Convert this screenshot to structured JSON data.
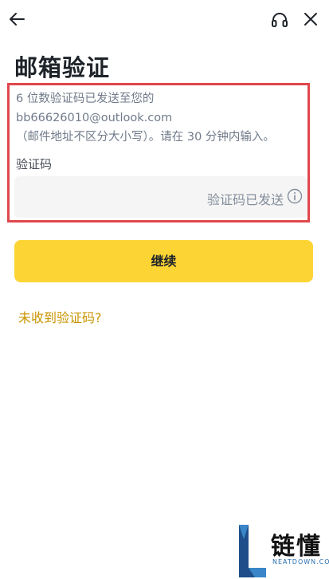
{
  "header": {
    "back_icon": "arrow-left-icon",
    "support_icon": "headset-icon",
    "close_icon": "close-icon"
  },
  "title": "邮箱验证",
  "info": {
    "line1": "6 位数验证码已发送至您的 bb66626010@outlook.com",
    "line2": "（邮件地址不区分大小写）。请在 30 分钟内输入。"
  },
  "code_field": {
    "label": "验证码",
    "value": "",
    "status": "验证码已发送",
    "status_icon": "info-circle-icon"
  },
  "continue_label": "继续",
  "resend_label": "未收到验证码?",
  "watermark": {
    "cn": "链懂",
    "en": "NEATDOWN.COM"
  },
  "colors": {
    "accent": "#fcd535",
    "link": "#c99400",
    "highlight": "#e0474c",
    "text_secondary": "#707a8a"
  }
}
